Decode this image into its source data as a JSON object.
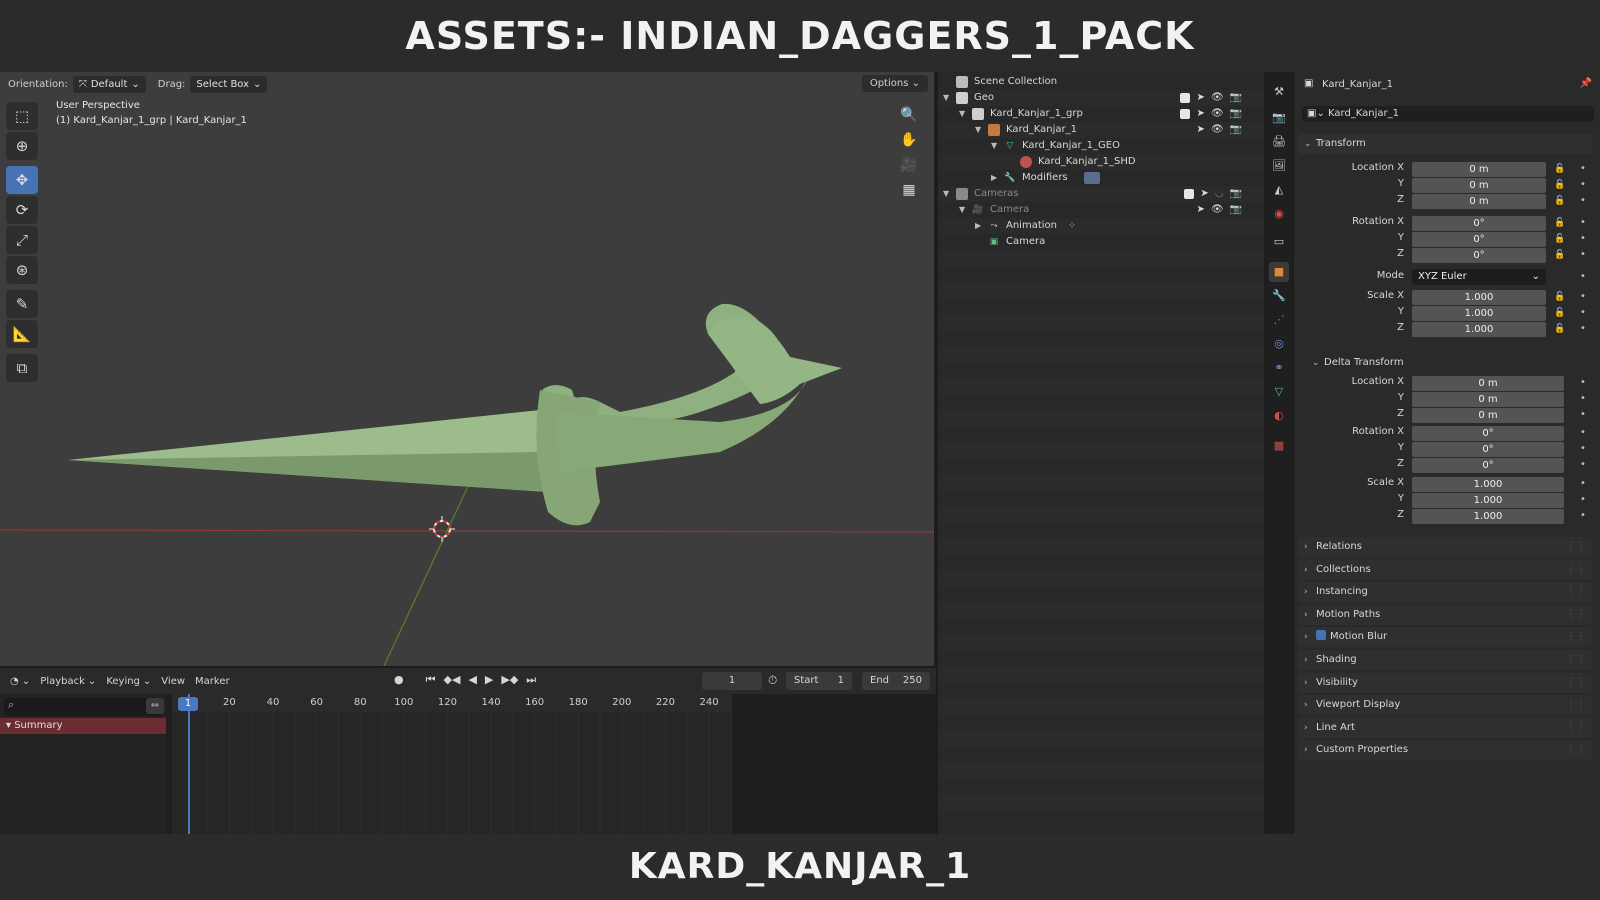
{
  "banner": {
    "top": "ASSETS:- INDIAN_DAGGERS_1_PACK",
    "bottom": "KARD_KANJAR_1"
  },
  "viewport": {
    "orientation_label": "Orientation:",
    "orientation_value": "Default",
    "drag_label": "Drag:",
    "drag_value": "Select Box",
    "options_label": "Options",
    "perspective": "User Perspective",
    "object_info": "(1) Kard_Kanjar_1_grp | Kard_Kanjar_1",
    "object_color": "#8fb07f",
    "tools": [
      "select-box-icon",
      "cursor-icon",
      "move-icon",
      "rotate-icon",
      "scale-icon",
      "transform-icon",
      "annotate-icon",
      "measure-icon",
      "add-cube-icon"
    ],
    "nav": [
      "zoom-icon",
      "pan-hand-icon",
      "camera-view-icon",
      "grid-view-icon"
    ]
  },
  "timeline": {
    "menus": [
      "Playback",
      "Keying",
      "View",
      "Marker"
    ],
    "current_frame": "1",
    "start_label": "Start",
    "start_value": "1",
    "end_label": "End",
    "end_value": "250",
    "ruler": [
      "20",
      "40",
      "60",
      "80",
      "100",
      "120",
      "140",
      "160",
      "180",
      "200",
      "220",
      "240"
    ],
    "cursor_label": "1",
    "summary": "Summary"
  },
  "outliner": {
    "root": "Scene Collection",
    "rows": [
      {
        "label": "Geo",
        "type": "collection"
      },
      {
        "label": "Kard_Kanjar_1_grp",
        "type": "collection"
      },
      {
        "label": "Kard_Kanjar_1",
        "type": "object"
      },
      {
        "label": "Kard_Kanjar_1_GEO",
        "type": "mesh"
      },
      {
        "label": "Kard_Kanjar_1_SHD",
        "type": "material"
      },
      {
        "label": "Modifiers",
        "type": "modifier"
      },
      {
        "label": "Cameras",
        "type": "collection"
      },
      {
        "label": "Camera",
        "type": "camera-object"
      },
      {
        "label": "Animation",
        "type": "animation"
      },
      {
        "label": "Camera",
        "type": "camera-data"
      }
    ]
  },
  "properties": {
    "object_name": "Kard_Kanjar_1",
    "name_field": "Kard_Kanjar_1",
    "transform": {
      "title": "Transform",
      "location_x_label": "Location X",
      "location_x": "0 m",
      "location_y": "0 m",
      "location_z": "0 m",
      "rotation_x_label": "Rotation X",
      "rotation_x": "0°",
      "rotation_y": "0°",
      "rotation_z": "0°",
      "mode_label": "Mode",
      "mode": "XYZ Euler",
      "scale_x_label": "Scale X",
      "scale_x": "1.000",
      "scale_y": "1.000",
      "scale_z": "1.000"
    },
    "delta": {
      "title": "Delta Transform",
      "location_x": "0 m",
      "location_y": "0 m",
      "location_z": "0 m",
      "rotation_x": "0°",
      "rotation_y": "0°",
      "rotation_z": "0°",
      "scale_x": "1.000",
      "scale_y": "1.000",
      "scale_z": "1.000"
    },
    "axis_y": "Y",
    "axis_z": "Z",
    "panels": [
      "Relations",
      "Collections",
      "Instancing",
      "Motion Paths",
      "Motion Blur",
      "Shading",
      "Visibility",
      "Viewport Display",
      "Line Art",
      "Custom Properties"
    ]
  }
}
